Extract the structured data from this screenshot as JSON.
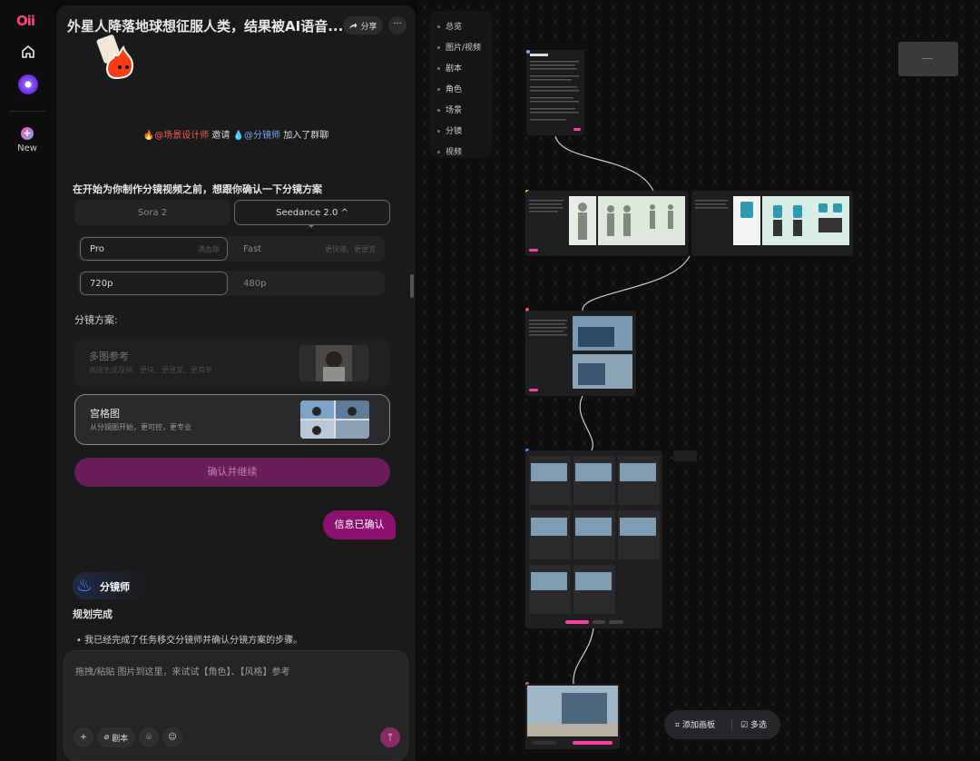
{
  "brand": {
    "logo": "Oii",
    "accent": "#ff3d7f"
  },
  "rail": {
    "new_label": "New"
  },
  "header": {
    "title": "外星人降落地球想征服人类，结果被AI语音...",
    "share_label": "分享",
    "more_label": "···"
  },
  "invite": {
    "mention1": "@场景设计师",
    "verb": " 邀请 ",
    "mention2": "@分镜师",
    "tail": " 加入了群聊"
  },
  "question": "在开始为你制作分镜视频之前，想跟你确认一下分镜方案",
  "model_tabs": [
    {
      "label": "Sora 2"
    },
    {
      "label": "Seedance 2.0 ^"
    }
  ],
  "quality": [
    {
      "label": "Pro",
      "sub": "满血版"
    },
    {
      "label": "Fast",
      "sub": "更快速、更便宜"
    }
  ],
  "resolution": [
    {
      "label": "720p"
    },
    {
      "label": "480p"
    }
  ],
  "storyboard_label": "分镜方案:",
  "options": [
    {
      "title": "多图参考",
      "desc": "直接生成视频、更快、更便宜、更简单"
    },
    {
      "title": "宫格图",
      "desc": "从分镜图开始，更可控，更专业"
    }
  ],
  "confirm_label": "确认并继续",
  "user_msg": "信息已确认",
  "agent": {
    "name": "分镜师"
  },
  "plan_done": "规划完成",
  "bullet": "我已经完成了任务移交分镜师并确认分镜方案的步骤。",
  "composer": {
    "placeholder": "拖拽/粘贴 图片到这里，来试试【角色】、【风格】参考",
    "script_btn": "剧本",
    "send_icon": "arrow-up-icon"
  },
  "canvas_nav": [
    "总览",
    "图片/视频",
    "剧本",
    "角色",
    "场景",
    "分镜",
    "视频"
  ],
  "toolbar": {
    "add_board": "添加画板",
    "multi_select": "多选"
  },
  "colors": {
    "panel": "#1a1a1b",
    "confirm": "#6b1d5b",
    "bubble": "#8b1070",
    "canvas": "#0e0e0f"
  }
}
